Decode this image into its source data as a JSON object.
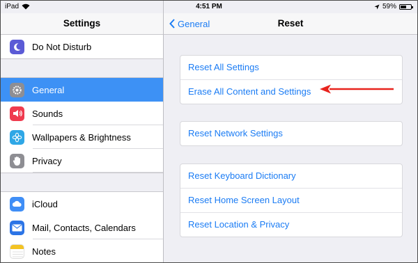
{
  "status_bar": {
    "device": "iPad",
    "time": "4:51 PM",
    "battery": "59%",
    "battery_level": 0.59
  },
  "sidebar": {
    "title": "Settings",
    "groups": [
      {
        "items": [
          {
            "label": "Do Not Disturb",
            "icon": "moon-icon",
            "color": "#5b5bd6"
          }
        ]
      },
      {
        "items": [
          {
            "label": "General",
            "icon": "gear-icon",
            "color": "#8e8e93",
            "selected": true
          },
          {
            "label": "Sounds",
            "icon": "speaker-icon",
            "color": "#ef3b4f"
          },
          {
            "label": "Wallpapers & Brightness",
            "icon": "flower-icon",
            "color": "#2fa7e6"
          },
          {
            "label": "Privacy",
            "icon": "hand-icon",
            "color": "#8e8e93"
          }
        ]
      },
      {
        "items": [
          {
            "label": "iCloud",
            "icon": "cloud-icon",
            "color": "#3f8ef6"
          },
          {
            "label": "Mail, Contacts, Calendars",
            "icon": "mail-icon",
            "color": "#2b74e6"
          },
          {
            "label": "Notes",
            "icon": "notes-icon",
            "color": "#f3c323"
          }
        ]
      }
    ]
  },
  "detail": {
    "back_label": "General",
    "title": "Reset",
    "sections": [
      [
        "Reset All Settings",
        "Erase All Content and Settings"
      ],
      [
        "Reset Network Settings"
      ],
      [
        "Reset Keyboard Dictionary",
        "Reset Home Screen Layout",
        "Reset Location & Privacy"
      ]
    ]
  },
  "colors": {
    "accent": "#1b7cf4",
    "selection": "#3d91f5",
    "annotation_arrow": "#e8231d"
  }
}
